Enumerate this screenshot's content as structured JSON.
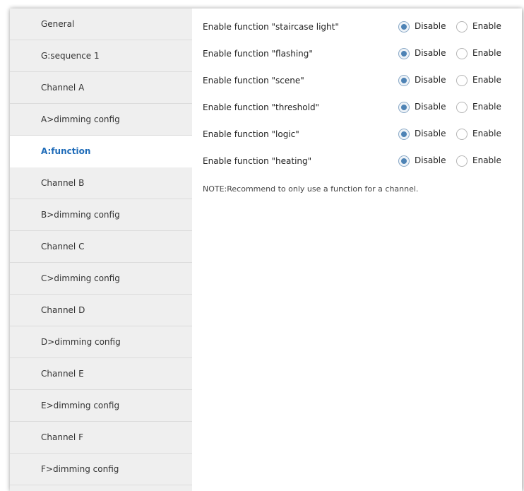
{
  "sidebar": {
    "items": [
      {
        "label": "General",
        "active": false
      },
      {
        "label": "G:sequence 1",
        "active": false
      },
      {
        "label": "Channel A",
        "active": false
      },
      {
        "label": "A>dimming config",
        "active": false
      },
      {
        "label": "A:function",
        "active": true
      },
      {
        "label": "Channel B",
        "active": false
      },
      {
        "label": "B>dimming config",
        "active": false
      },
      {
        "label": "Channel C",
        "active": false
      },
      {
        "label": "C>dimming config",
        "active": false
      },
      {
        "label": "Channel D",
        "active": false
      },
      {
        "label": "D>dimming config",
        "active": false
      },
      {
        "label": "Channel E",
        "active": false
      },
      {
        "label": "E>dimming config",
        "active": false
      },
      {
        "label": "Channel F",
        "active": false
      },
      {
        "label": "F>dimming config",
        "active": false
      }
    ]
  },
  "main": {
    "options": {
      "disable": "Disable",
      "enable": "Enable"
    },
    "params": [
      {
        "label": "Enable function \"staircase light\"",
        "selected": "Disable"
      },
      {
        "label": "Enable function \"flashing\"",
        "selected": "Disable"
      },
      {
        "label": "Enable function \"scene\"",
        "selected": "Disable"
      },
      {
        "label": "Enable function \"threshold\"",
        "selected": "Disable"
      },
      {
        "label": "Enable function \"logic\"",
        "selected": "Disable"
      },
      {
        "label": "Enable function \"heating\"",
        "selected": "Disable"
      }
    ],
    "note": "NOTE:Recommend to only use a function for a channel."
  },
  "colors": {
    "accent": "#1e6bb8",
    "sidebar_bg": "#efefef",
    "radio_dot": "#4e83b5"
  }
}
